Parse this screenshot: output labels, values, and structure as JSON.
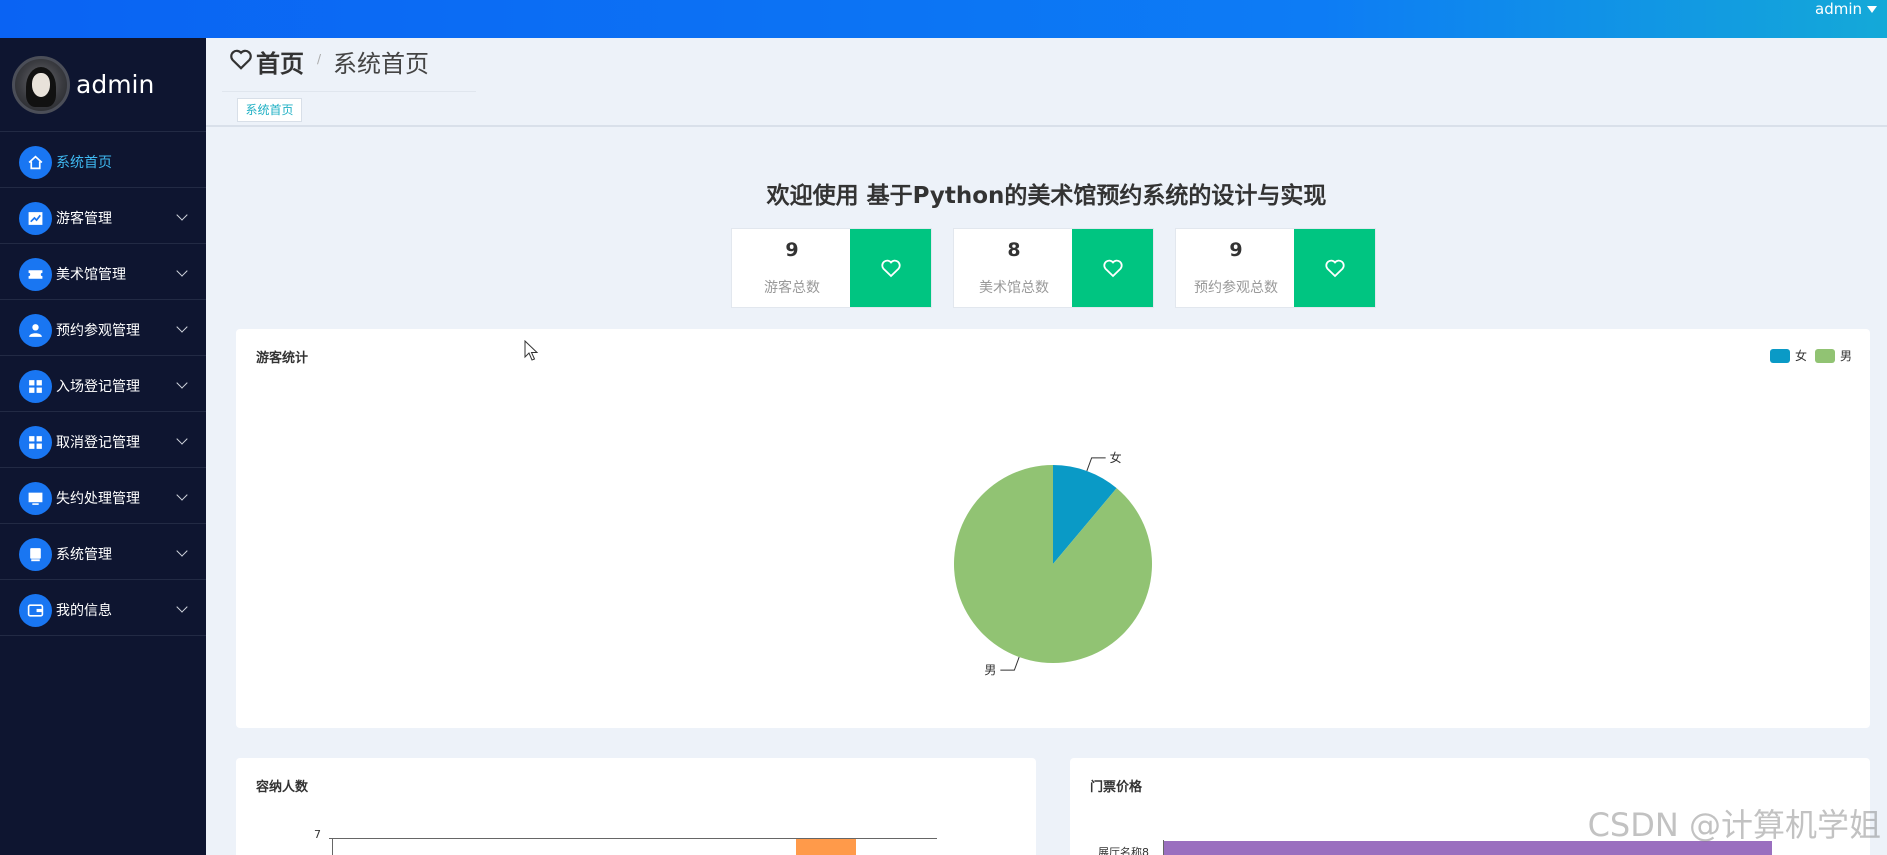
{
  "header": {
    "user": "admin"
  },
  "sidebar": {
    "profile_name": "admin",
    "items": [
      {
        "label": "系统首页",
        "icon": "home-icon",
        "active": true
      },
      {
        "label": "游客管理",
        "icon": "chart-icon"
      },
      {
        "label": "美术馆管理",
        "icon": "ticket-icon"
      },
      {
        "label": "预约参观管理",
        "icon": "user-icon"
      },
      {
        "label": "入场登记管理",
        "icon": "grid-icon"
      },
      {
        "label": "取消登记管理",
        "icon": "grid-icon"
      },
      {
        "label": "失约处理管理",
        "icon": "monitor-icon"
      },
      {
        "label": "系统管理",
        "icon": "printer-icon"
      },
      {
        "label": "我的信息",
        "icon": "wallet-icon"
      }
    ]
  },
  "breadcrumb": {
    "home": "首页",
    "separator": "/",
    "current": "系统首页"
  },
  "tabs": [
    {
      "label": "系统首页"
    }
  ],
  "welcome": "欢迎使用 基于Python的美术馆预约系统的设计与实现",
  "stats": [
    {
      "value": "9",
      "label": "游客总数"
    },
    {
      "value": "8",
      "label": "美术馆总数"
    },
    {
      "value": "9",
      "label": "预约参观总数"
    }
  ],
  "colors": {
    "accent": "#00c581",
    "sidebar_bg": "#0e1530",
    "female": "#0a9ac6",
    "male": "#91c373",
    "bar_orange": "#ff9a4a",
    "bar_purple": "#9a6fbf"
  },
  "cards": {
    "visitors": {
      "title": "游客统计"
    },
    "capacity": {
      "title": "容纳人数"
    },
    "price": {
      "title": "门票价格"
    }
  },
  "chart_data": [
    {
      "type": "pie",
      "title": "游客统计",
      "categories": [
        "女",
        "男"
      ],
      "values": [
        1,
        8
      ],
      "legend_position": "top-right"
    },
    {
      "type": "bar",
      "title": "容纳人数",
      "y_tick_labels": [
        "7"
      ],
      "categories": [],
      "values": []
    },
    {
      "type": "bar",
      "title": "门票价格",
      "orientation": "horizontal",
      "categories": [
        "展厅名称8"
      ],
      "values": []
    }
  ],
  "watermark": "CSDN @计算机学姐"
}
